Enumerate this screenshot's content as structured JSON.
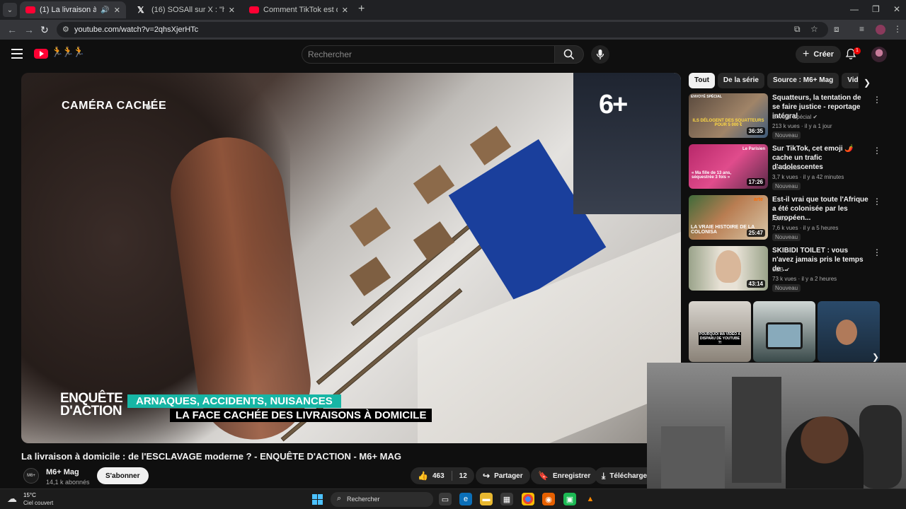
{
  "browser": {
    "tabs": [
      {
        "title": "(1) La livraison à domicile : d",
        "active": true,
        "favicon": "youtube-icon"
      },
      {
        "title": "(16) SOSAll sur X : \"https://t.co/",
        "active": false,
        "favicon": "x-icon"
      },
      {
        "title": "Comment TikTok est devenu u",
        "active": false,
        "favicon": "youtube-icon"
      }
    ],
    "url": "youtube.com/watch?v=2qhsXjerHTc"
  },
  "header": {
    "search_placeholder": "Rechercher",
    "create_label": "Créer",
    "notification_count": "1"
  },
  "video": {
    "overlay": {
      "camera_tag": "CAMÉRA CACHÉE",
      "channel_logo": "6+",
      "show_name_line1": "ENQUÊTE",
      "show_name_line2": "D'ACTION",
      "lower_third_1": "ARNAQUES, ACCIDENTS, NUISANCES",
      "lower_third_2": "LA FACE CACHÉE DES LIVRAISONS À DOMICILE"
    },
    "title": "La livraison à domicile : de l'ESCLAVAGE moderne ? - ENQUÊTE D'ACTION - M6+ MAG",
    "channel": {
      "name": "M6+ Mag",
      "subscribers": "14,1 k abonnés",
      "avatar_text": "M6+"
    },
    "subscribe_label": "S'abonner",
    "likes": "463",
    "comments": "12",
    "share_label": "Partager",
    "save_label": "Enregistrer",
    "download_label": "Télécharge"
  },
  "sidebar": {
    "chips": [
      "Tout",
      "De la série",
      "Source : M6+ Mag",
      "Vidéo"
    ],
    "recommendations": [
      {
        "title": "Squatteurs, la tentation de se faire justice - reportage intégral",
        "channel": "Envoyé Spécial",
        "meta": "213 k vues · il y a 1 jour",
        "badge": "Nouveau",
        "duration": "36:35",
        "thumb_text": "ILS DÉLOGENT DES SQUATTEURS POUR 5 000 €",
        "thumb_corner": "ENVOYÉ SPÉCIAL"
      },
      {
        "title": "Sur TikTok, cet emoji 🌶️ cache un trafic d'adolescentes",
        "channel": "Le Parisien",
        "meta": "3,7 k vues · il y a 42 minutes",
        "badge": "Nouveau",
        "duration": "17:26",
        "thumb_text": "« Ma fille de 13 ans, séquestrée 3 fois »",
        "thumb_corner": "Le Parisien"
      },
      {
        "title": "Est-il vrai que toute l'Afrique a été colonisée par les Européen...",
        "channel": "ARTE",
        "meta": "7,6 k vues · il y a 5 heures",
        "badge": "Nouveau",
        "duration": "25:47",
        "thumb_text": "LA VRAIE HISTOIRE DE LA COLONISA",
        "thumb_corner": "arte"
      },
      {
        "title": "SKIBIDI TOILET : vous n'avez jamais pris le temps de ...",
        "channel": "SEB",
        "meta": "73 k vues · il y a 2 heures",
        "badge": "Nouveau",
        "duration": "43:14",
        "thumb_text": "",
        "thumb_corner": ""
      }
    ],
    "shorts": [
      {
        "caption": "POURQUOI MA VIDÉO A DISPARU DE YOUTUBE ?!"
      },
      {
        "caption": ""
      },
      {
        "caption": ""
      }
    ]
  },
  "taskbar": {
    "temperature": "15°C",
    "weather": "Ciel couvert",
    "search_label": "Rechercher"
  }
}
